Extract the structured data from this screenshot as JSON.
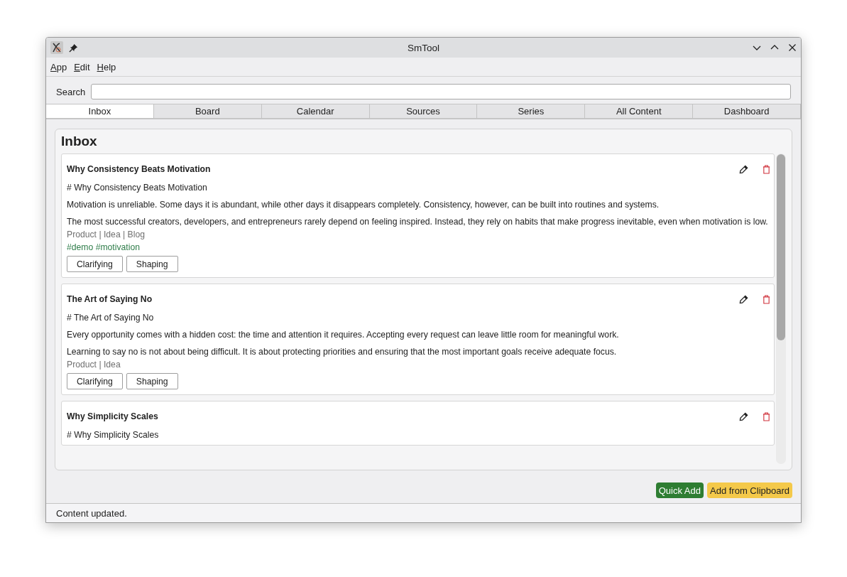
{
  "window": {
    "title": "SmTool"
  },
  "menu": [
    "App",
    "Edit",
    "Help"
  ],
  "search": {
    "label": "Search"
  },
  "tabs": [
    {
      "label": "Inbox",
      "selected": true
    },
    {
      "label": "Board",
      "selected": false
    },
    {
      "label": "Calendar",
      "selected": false
    },
    {
      "label": "Sources",
      "selected": false
    },
    {
      "label": "Series",
      "selected": false
    },
    {
      "label": "All Content",
      "selected": false
    },
    {
      "label": "Dashboard",
      "selected": false
    }
  ],
  "panel": {
    "title": "Inbox",
    "cards": [
      {
        "title": "Why Consistency Beats Motivation",
        "heading": "# Why Consistency Beats Motivation",
        "paragraphs": [
          "Motivation is unreliable. Some days it is abundant, while other days it disappears completely. Consistency, however, can be built into routines and systems.",
          "The most successful creators, developers, and entrepreneurs rarely depend on feeling inspired. Instead, they rely on habits that make progress inevitable, even when motivation is low."
        ],
        "categories": "Product | Idea | Blog",
        "tags": "#demo #motivation",
        "stages": [
          "Clarifying",
          "Shaping"
        ]
      },
      {
        "title": "The Art of Saying No",
        "heading": "# The Art of Saying No",
        "paragraphs": [
          "Every opportunity comes with a hidden cost: the time and attention it requires. Accepting every request can leave little room for meaningful work.",
          "Learning to say no is not about being difficult. It is about protecting priorities and ensuring that the most important goals receive adequate focus."
        ],
        "categories": "Product | Idea",
        "stages": [
          "Clarifying",
          "Shaping"
        ]
      },
      {
        "title": "Why Simplicity Scales",
        "heading": "# Why Simplicity Scales"
      }
    ]
  },
  "actions": [
    {
      "label": "Quick Add",
      "kind": "primary"
    },
    {
      "label": "Add from Clipboard",
      "kind": "warning"
    }
  ],
  "status_bar": "Content updated."
}
